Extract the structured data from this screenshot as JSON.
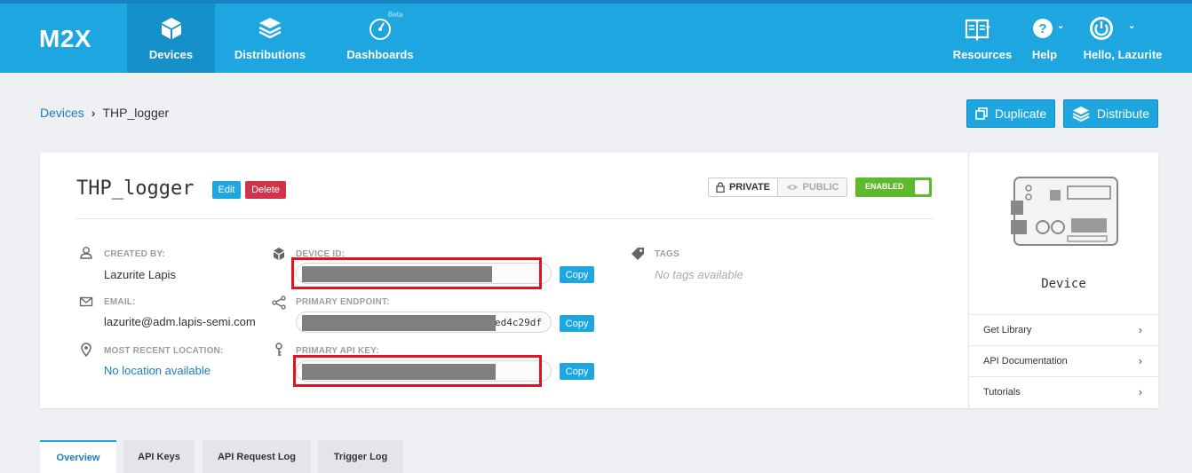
{
  "app": {
    "logo": "M2X"
  },
  "nav": {
    "items": [
      {
        "label": "Devices",
        "icon": "cube-icon",
        "active": true
      },
      {
        "label": "Distributions",
        "icon": "layers-icon"
      },
      {
        "label": "Dashboards",
        "icon": "gauge-icon",
        "badge": "Beta"
      }
    ],
    "right": [
      {
        "label": "Resources",
        "icon": "book-icon"
      },
      {
        "label": "Help",
        "icon": "question-icon"
      },
      {
        "label": "Hello, Lazurite",
        "icon": "power-icon"
      }
    ]
  },
  "breadcrumb": {
    "root": "Devices",
    "sep": "›",
    "current": "THP_logger"
  },
  "actions": {
    "duplicate": "Duplicate",
    "distribute": "Distribute"
  },
  "device": {
    "name": "THP_logger",
    "edit": "Edit",
    "delete": "Delete",
    "privacy": {
      "private": "PRIVATE",
      "public": "PUBLIC",
      "selected": "private"
    },
    "status": "ENABLED",
    "created_by": {
      "label": "CREATED BY:",
      "value": "Lazurite Lapis"
    },
    "email": {
      "label": "EMAIL:",
      "value": "lazurite@adm.lapis-semi.com"
    },
    "location": {
      "label": "MOST RECENT LOCATION:",
      "value": "No location available"
    },
    "device_id": {
      "label": "DEVICE ID:"
    },
    "endpoint": {
      "label": "PRIMARY ENDPOINT:",
      "visible_tail": "ed4c29df"
    },
    "api_key": {
      "label": "PRIMARY API KEY:"
    },
    "copy": "Copy",
    "tags": {
      "label": "TAGS",
      "empty": "No tags available"
    }
  },
  "sidebar": {
    "device_label": "Device",
    "links": [
      "Get Library",
      "API Documentation",
      "Tutorials"
    ],
    "chevron": "›"
  },
  "tabs": [
    {
      "label": "Overview",
      "active": true
    },
    {
      "label": "API Keys"
    },
    {
      "label": "API Request Log"
    },
    {
      "label": "Trigger Log"
    }
  ],
  "colors": {
    "brand": "#1da6e0",
    "danger": "#d0334a",
    "enabled": "#5dba2d",
    "highlight": "#e0141e"
  }
}
